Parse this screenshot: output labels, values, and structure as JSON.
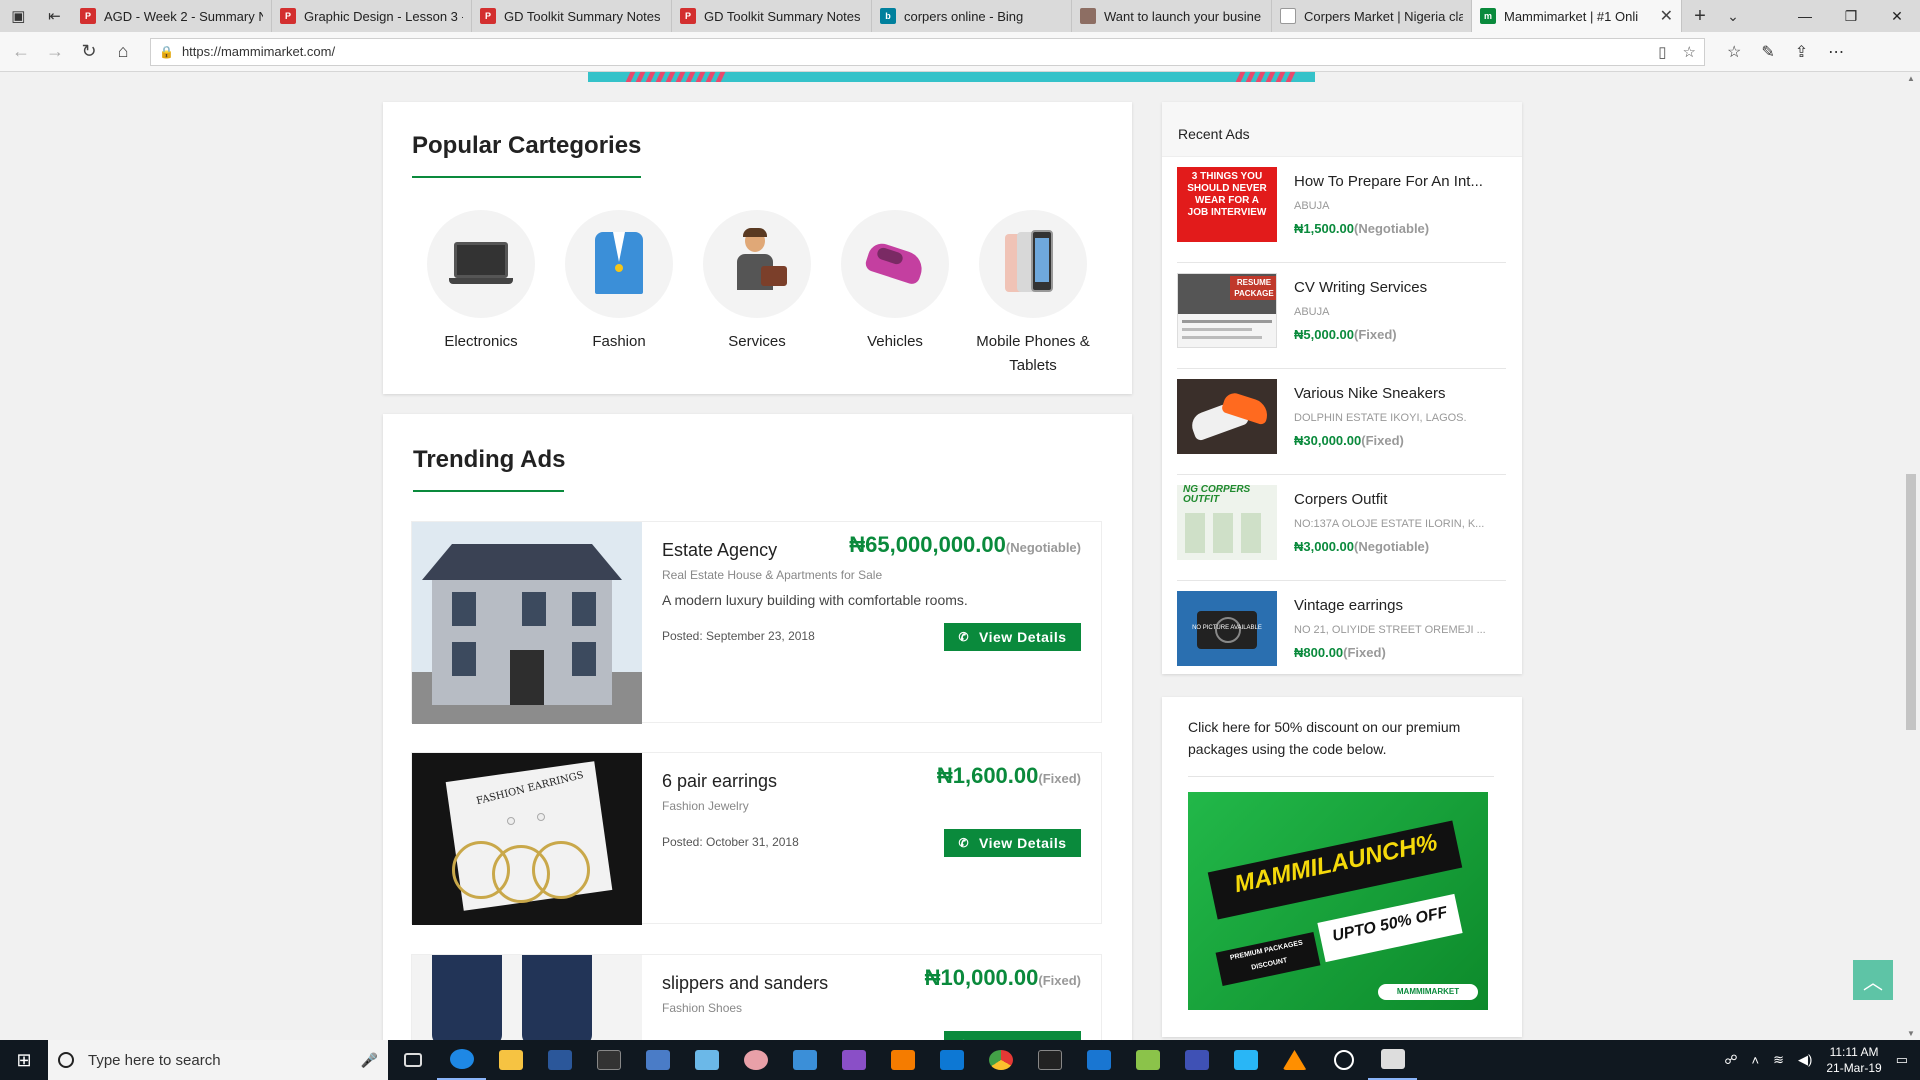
{
  "browser": {
    "tabs": [
      {
        "title": "AGD - Week 2 - Summary N",
        "icon": "pdf-icon",
        "color": "#d32f2f"
      },
      {
        "title": "Graphic Design - Lesson 3 -",
        "icon": "pdf-icon",
        "color": "#d32f2f"
      },
      {
        "title": "GD Toolkit Summary Notes",
        "icon": "pdf-icon",
        "color": "#d32f2f"
      },
      {
        "title": "GD Toolkit Summary Notes",
        "icon": "pdf-icon",
        "color": "#d32f2f"
      },
      {
        "title": "corpers online - Bing",
        "icon": "bing-icon",
        "color": "#00809d"
      },
      {
        "title": "Want to launch your busine",
        "icon": "avatar-icon",
        "color": "#8d6e63"
      },
      {
        "title": "Corpers Market | Nigeria cla",
        "icon": "page-icon",
        "color": "#9e9e9e"
      },
      {
        "title": "Mammimarket | #1 Onli",
        "icon": "mammimarket-icon",
        "color": "#0a8a3c"
      }
    ],
    "url": "https://mammimarket.com/"
  },
  "popular": {
    "title": "Popular Cartegories",
    "categories": [
      {
        "label": "Electronics",
        "icon": "laptop-icon"
      },
      {
        "label": "Fashion",
        "icon": "blazer-icon"
      },
      {
        "label": "Services",
        "icon": "businessman-icon"
      },
      {
        "label": "Vehicles",
        "icon": "car-icon"
      },
      {
        "label": "Mobile Phones & Tablets",
        "icon": "phones-icon"
      }
    ]
  },
  "trending": {
    "title": "Trending Ads",
    "button_label": "View Details",
    "ads": [
      {
        "title": "Estate Agency",
        "price": "₦65,000,000.00",
        "price_note": "(Negotiable)",
        "category": "Real Estate  House & Apartments for Sale",
        "description": "A modern luxury building with comfortable rooms.",
        "posted": "Posted: September 23, 2018"
      },
      {
        "title": "6 pair earrings",
        "price": "₦1,600.00",
        "price_note": "(Fixed)",
        "category": "Fashion  Jewelry",
        "description": "",
        "posted": "Posted: October 31, 2018",
        "image_text": "FASHION EARRINGS"
      },
      {
        "title": "slippers and sanders",
        "price": "₦10,000.00",
        "price_note": "(Fixed)",
        "category": "Fashion  Shoes",
        "description": "",
        "posted": ""
      }
    ]
  },
  "recent": {
    "title": "Recent Ads",
    "ads": [
      {
        "title": "How To Prepare For An Int...",
        "location": "ABUJA",
        "price": "₦1,500.00",
        "price_note": "(Negotiable)",
        "image_text": "3 THINGS YOU SHOULD NEVER WEAR FOR A JOB INTERVIEW"
      },
      {
        "title": "CV Writing Services",
        "location": "ABUJA",
        "price": "₦5,000.00",
        "price_note": "(Fixed)",
        "image_text": "RESUME PACKAGE"
      },
      {
        "title": "Various Nike Sneakers",
        "location": "DOLPHIN ESTATE IKOYI, LAGOS.",
        "price": "₦30,000.00",
        "price_note": "(Fixed)"
      },
      {
        "title": "Corpers Outfit",
        "location": "NO:137A OLOJE ESTATE ILORIN, K...",
        "price": "₦3,000.00",
        "price_note": "(Negotiable)",
        "image_text": "NG CORPERS OUTFIT"
      },
      {
        "title": "Vintage earrings",
        "location": "NO 21, OLIYIDE STREET OREMEJI ...",
        "price": "₦800.00",
        "price_note": "(Fixed)",
        "image_text": "NO PICTURE AVAILABLE"
      }
    ]
  },
  "promo": {
    "text": "Click here for 50% discount on our premium packages using the code below.",
    "code": "MAMMILAUNCH%",
    "offer": "UPTO 50% OFF",
    "tag": "PREMIUM PACKAGES DISCOUNT",
    "brand": "MAMMIMARKET"
  },
  "taskbar": {
    "search_placeholder": "Type here to search",
    "time": "11:11 AM",
    "date": "21-Mar-19"
  },
  "colors": {
    "accent": "#0a8a3c",
    "banner": "#35c2c9",
    "back_to_top": "#5ec4a6"
  }
}
